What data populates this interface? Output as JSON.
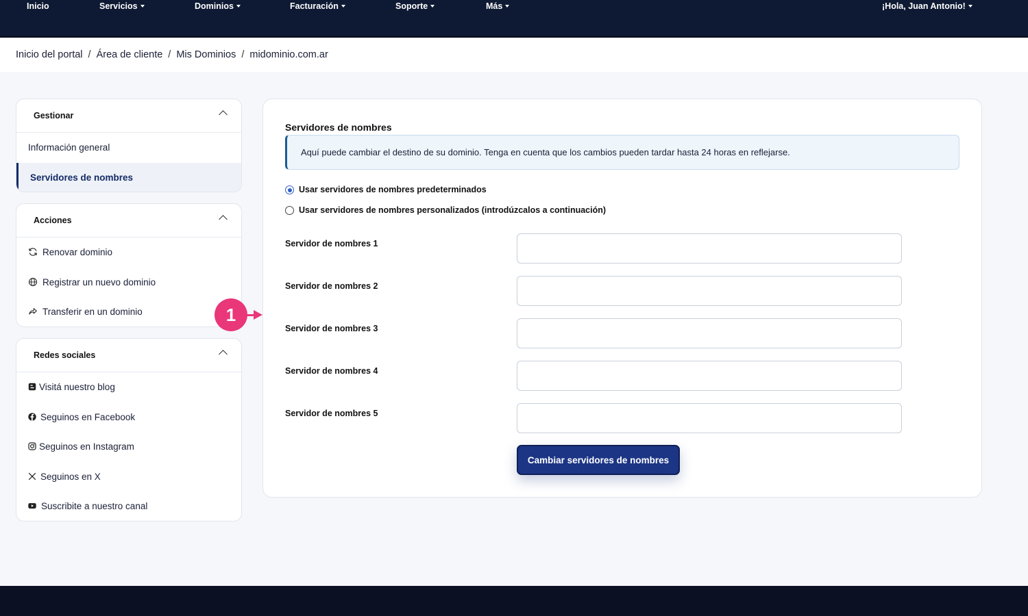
{
  "nav": {
    "items": [
      {
        "label": "Inicio",
        "dropdown": false
      },
      {
        "label": "Servicios",
        "dropdown": true
      },
      {
        "label": "Dominios",
        "dropdown": true
      },
      {
        "label": "Facturación",
        "dropdown": true
      },
      {
        "label": "Soporte",
        "dropdown": true
      },
      {
        "label": "Más",
        "dropdown": true
      }
    ],
    "user": "¡Hola, Juan Antonio!"
  },
  "breadcrumb": [
    "Inicio del portal",
    "Área de cliente",
    "Mis Dominios",
    "midominio.com.ar"
  ],
  "sidebar": {
    "manage": {
      "title": "Gestionar",
      "items": [
        {
          "label": "Información general",
          "active": false
        },
        {
          "label": "Servidores de nombres",
          "active": true
        }
      ]
    },
    "actions": {
      "title": "Acciones",
      "items": [
        {
          "label": "Renovar dominio",
          "icon": "refresh-icon"
        },
        {
          "label": "Registrar un nuevo dominio",
          "icon": "globe-icon"
        },
        {
          "label": "Transferir en un dominio",
          "icon": "share-icon"
        }
      ]
    },
    "social": {
      "title": "Redes sociales",
      "items": [
        {
          "label": "Visitá nuestro blog",
          "icon": "blogger-icon"
        },
        {
          "label": "Seguinos en Facebook",
          "icon": "facebook-icon"
        },
        {
          "label": "Seguinos en Instagram",
          "icon": "instagram-icon"
        },
        {
          "label": "Seguinos en X",
          "icon": "x-icon"
        },
        {
          "label": "Suscribite a nuestro canal",
          "icon": "youtube-icon"
        }
      ]
    }
  },
  "main": {
    "title": "Servidores de nombres",
    "alert": "Aquí puede cambiar el destino de su dominio. Tenga en cuenta que los cambios pueden tardar hasta 24 horas en reflejarse.",
    "options": [
      {
        "label": "Usar servidores de nombres predeterminados",
        "checked": true
      },
      {
        "label": "Usar servidores de nombres personalizados (introdúzcalos a continuación)",
        "checked": false
      }
    ],
    "nameservers": [
      {
        "label": "Servidor de nombres 1",
        "value": ""
      },
      {
        "label": "Servidor de nombres 2",
        "value": ""
      },
      {
        "label": "Servidor de nombres 3",
        "value": ""
      },
      {
        "label": "Servidor de nombres 4",
        "value": ""
      },
      {
        "label": "Servidor de nombres 5",
        "value": ""
      }
    ],
    "submit_label": "Cambiar servidores de nombres"
  },
  "annotation": {
    "marker": "1"
  },
  "colors": {
    "nav_bg": "#0e1a33",
    "accent": "#1c3585",
    "marker": "#e9377a"
  }
}
